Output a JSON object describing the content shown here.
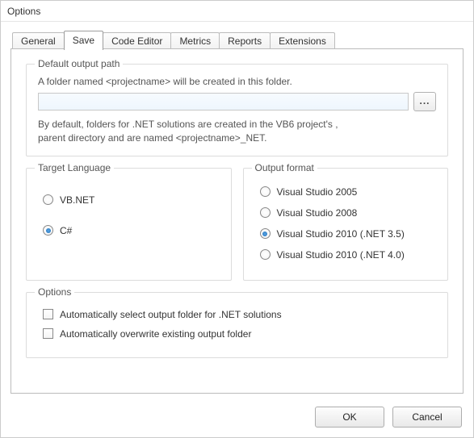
{
  "window": {
    "title": "Options"
  },
  "tabs": {
    "general": "General",
    "save": "Save",
    "code_editor": "Code Editor",
    "metrics": "Metrics",
    "reports": "Reports",
    "extensions": "Extensions"
  },
  "default_output_path": {
    "legend": "Default output path",
    "desc": "A folder named <projectname> will be created in this folder.",
    "value": "",
    "browse_label": "...",
    "hint_line1": "By default, folders for .NET solutions are created in the VB6 project's ,",
    "hint_line2": "parent directory and are named <projectname>_NET."
  },
  "target_language": {
    "legend": "Target Language",
    "options": {
      "vbnet": "VB.NET",
      "csharp": "C#"
    },
    "selected": "csharp"
  },
  "output_format": {
    "legend": "Output format",
    "options": {
      "vs2005": "Visual Studio 2005",
      "vs2008": "Visual Studio 2008",
      "vs2010_35": "Visual Studio 2010 (.NET 3.5)",
      "vs2010_40": "Visual Studio 2010 (.NET 4.0)"
    },
    "selected": "vs2010_35"
  },
  "options_group": {
    "legend": "Options",
    "auto_select": "Automatically select output folder for .NET solutions",
    "auto_overwrite": "Automatically overwrite existing output folder"
  },
  "buttons": {
    "ok": "OK",
    "cancel": "Cancel"
  }
}
